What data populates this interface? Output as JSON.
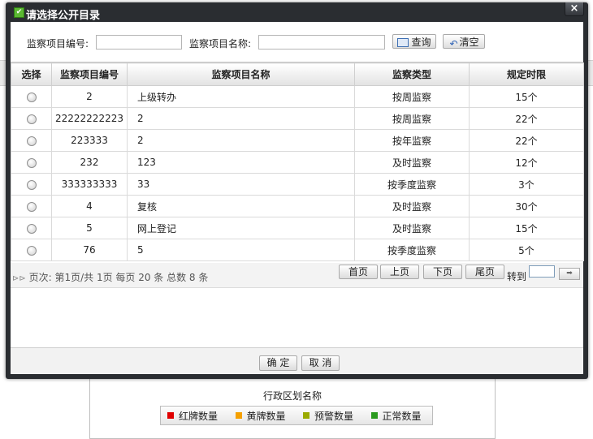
{
  "dialog": {
    "title": "请选择公开目录",
    "close_label": "×",
    "check_mark": "✔"
  },
  "search": {
    "code_label": "监察项目编号:",
    "code_value": "",
    "name_label": "监察项目名称:",
    "name_value": "",
    "query_label": "查询",
    "clear_label": "清空"
  },
  "table": {
    "headers": [
      "选择",
      "监察项目编号",
      "监察项目名称",
      "监察类型",
      "规定时限"
    ],
    "rows": [
      {
        "code": "2",
        "name": "上级转办",
        "type": "按周监察",
        "limit": "15个"
      },
      {
        "code": "22222222223",
        "name": "2",
        "type": "按周监察",
        "limit": "22个"
      },
      {
        "code": "223333",
        "name": "2",
        "type": "按年监察",
        "limit": "22个"
      },
      {
        "code": "232",
        "name": "123",
        "type": "及时监察",
        "limit": "12个"
      },
      {
        "code": "333333333",
        "name": "33",
        "type": "按季度监察",
        "limit": "3个"
      },
      {
        "code": "4",
        "name": "复核",
        "type": "及时监察",
        "limit": "30个"
      },
      {
        "code": "5",
        "name": "网上登记",
        "type": "及时监察",
        "limit": "15个"
      },
      {
        "code": "76",
        "name": "5",
        "type": "按季度监察",
        "limit": "5个"
      }
    ]
  },
  "pager": {
    "arrow": "⊳⊳",
    "info": "页次: 第1页/共 1页 每页 20 条 总数 8 条",
    "first": "首页",
    "prev": "上页",
    "next": "下页",
    "last": "尾页",
    "goto_label": "转到",
    "go_glyph": "➡"
  },
  "footer": {
    "ok": "确 定",
    "cancel": "取 消"
  },
  "background": {
    "region_title": "行政区划名称",
    "legend": [
      {
        "label": "红牌数量",
        "color": "#e00000"
      },
      {
        "label": "黄牌数量",
        "color": "#f5a000"
      },
      {
        "label": "预警数量",
        "color": "#9aaa00"
      },
      {
        "label": "正常数量",
        "color": "#2a9a1e"
      }
    ]
  }
}
